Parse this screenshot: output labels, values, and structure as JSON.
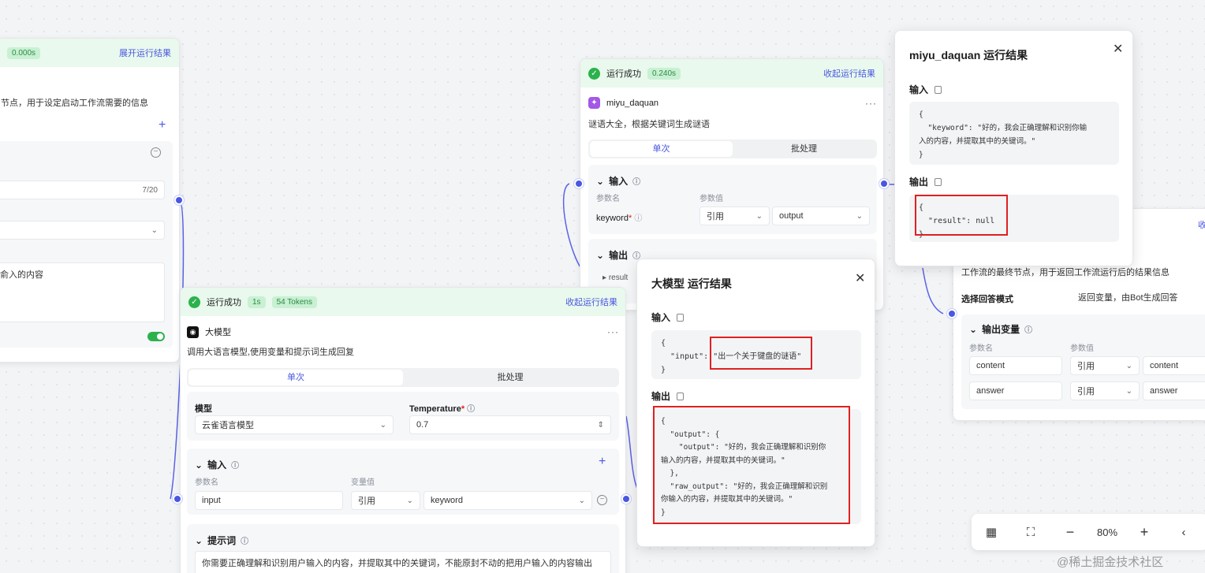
{
  "start_node": {
    "time": "0.000s",
    "expand": "展开运行结果",
    "desc": "节点，用于设定启动工作流需要的信息",
    "counter": "7/20",
    "text": "俞入的内容"
  },
  "miyu_node": {
    "status": "运行成功",
    "time": "0.240s",
    "collapse": "收起运行结果",
    "name": "miyu_daquan",
    "desc": "谜语大全，根据关键词生成谜语",
    "tab_single": "单次",
    "tab_batch": "批处理",
    "input_title": "输入",
    "col_param": "参数名",
    "col_value": "参数值",
    "param": "keyword",
    "ref": "引用",
    "value": "output",
    "output_title": "输出",
    "output_item": "result"
  },
  "llm_node": {
    "status": "运行成功",
    "time": "1s",
    "tokens": "54 Tokens",
    "collapse": "收起运行结果",
    "name": "大模型",
    "desc": "调用大语言模型,使用变量和提示词生成回复",
    "tab_single": "单次",
    "tab_batch": "批处理",
    "model_label": "模型",
    "model_value": "云雀语言模型",
    "temp_label": "Temperature",
    "temp_value": "0.7",
    "input_title": "输入",
    "col_param": "参数名",
    "col_value": "变量值",
    "param": "input",
    "ref": "引用",
    "value": "keyword",
    "prompt_title": "提示词",
    "prompt_text": "你需要正确理解和识别用户输入的内容，并提取其中的关键词，不能原封不动的把用户输入的内容输出"
  },
  "end_node": {
    "collapse_partial": "收",
    "desc": "工作流的最终节点，用于返回工作流运行后的结果信息",
    "mode_label": "选择回答模式",
    "mode_value": "返回变量，由Bot生成回答",
    "vars_title": "输出变量",
    "col_param": "参数名",
    "col_value": "参数值",
    "rows": [
      {
        "name": "content",
        "ref": "引用",
        "value": "content"
      },
      {
        "name": "answer",
        "ref": "引用",
        "value": "answer"
      }
    ]
  },
  "miyu_popup": {
    "title": "miyu_daquan  运行结果",
    "input_label": "输入",
    "input_code": "{\n  \"keyword\": \"好的，我会正确理解和识别你输\n入的内容，并提取其中的关键词。\"\n}",
    "output_label": "输出",
    "output_code": "{\n  \"result\": null\n}"
  },
  "llm_popup": {
    "title": "大模型  运行结果",
    "input_label": "输入",
    "input_code": "{\n  \"input\": \"出一个关于键盘的谜语\"\n}",
    "output_label": "输出",
    "output_code": "{\n  \"output\": {\n    \"output\": \"好的，我会正确理解和识别你\n输入的内容，并提取其中的关键词。\"\n  },\n  \"raw_output\": \"好的，我会正确理解和识别\n你输入的内容，并提取其中的关键词。\"\n}"
  },
  "toolbar": {
    "zoom": "80%",
    "minus": "−",
    "plus": "+"
  },
  "watermark": "@稀土掘金技术社区",
  "colors": {
    "accent": "#4a57e0",
    "success": "#2bb24c",
    "highlight": "#e02020"
  }
}
